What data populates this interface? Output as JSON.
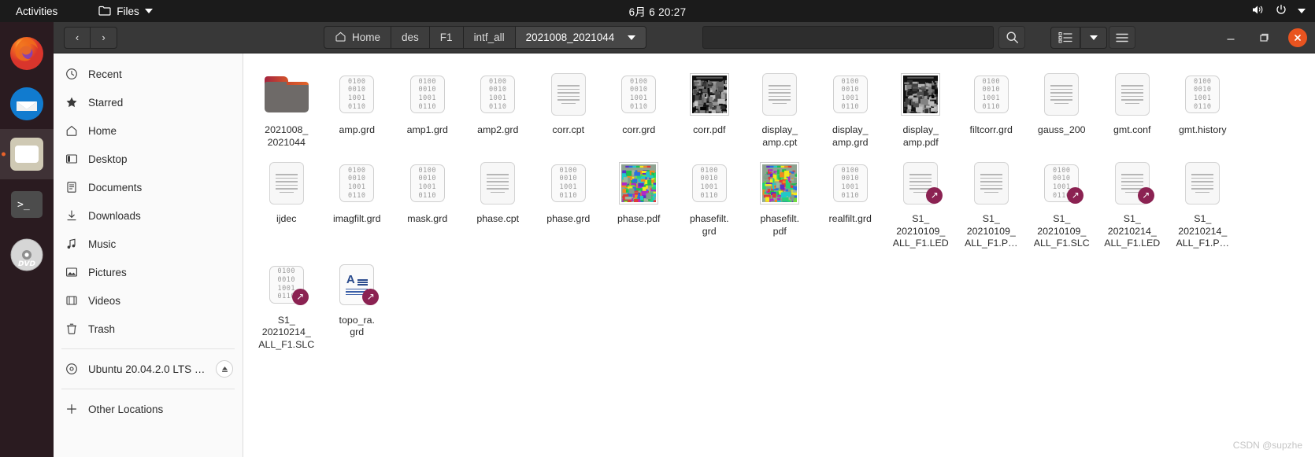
{
  "topbar": {
    "activities": "Activities",
    "app_name": "Files",
    "clock": "6月 6 20:27",
    "icons": {
      "folder": "folder-icon",
      "volume": "volume-icon",
      "power": "power-icon",
      "menu": "chevron-down-icon"
    }
  },
  "dock": {
    "items": [
      {
        "name": "firefox",
        "label": "Firefox",
        "active": false
      },
      {
        "name": "thunderbird",
        "label": "Thunderbird",
        "active": false
      },
      {
        "name": "files",
        "label": "Files",
        "active": true
      },
      {
        "name": "terminal",
        "label": "Terminal",
        "active": false
      },
      {
        "name": "dvd",
        "label": "DVD",
        "active": false
      }
    ]
  },
  "header": {
    "back": "‹",
    "forward": "›",
    "breadcrumb": [
      "Home",
      "des",
      "F1",
      "intf_all",
      "2021008_2021044"
    ],
    "path_entry_value": "",
    "search_label": "Search",
    "view_list_label": "List view",
    "view_dropdown_label": "View options",
    "menu_label": "Menu",
    "minimize": "—",
    "maximize": "❐",
    "close": "✕"
  },
  "sidebar": {
    "items": [
      {
        "label": "Recent",
        "icon": "clock-icon"
      },
      {
        "label": "Starred",
        "icon": "star-icon"
      },
      {
        "label": "Home",
        "icon": "home-icon"
      },
      {
        "label": "Desktop",
        "icon": "desktop-icon"
      },
      {
        "label": "Documents",
        "icon": "documents-icon"
      },
      {
        "label": "Downloads",
        "icon": "download-icon"
      },
      {
        "label": "Music",
        "icon": "music-icon"
      },
      {
        "label": "Pictures",
        "icon": "pictures-icon"
      },
      {
        "label": "Videos",
        "icon": "videos-icon"
      },
      {
        "label": "Trash",
        "icon": "trash-icon"
      }
    ],
    "device": {
      "label": "Ubuntu 20.04.2.0 LTS a…",
      "icon": "disc-icon",
      "eject": "⏏"
    },
    "other_locations": {
      "label": "Other Locations",
      "icon": "plus-icon"
    }
  },
  "files": [
    {
      "name": "2021008_\n2021044",
      "type": "folder",
      "symlink": false
    },
    {
      "name": "amp.grd",
      "type": "binary",
      "symlink": false
    },
    {
      "name": "amp1.grd",
      "type": "binary",
      "symlink": false
    },
    {
      "name": "amp2.grd",
      "type": "binary",
      "symlink": false
    },
    {
      "name": "corr.cpt",
      "type": "doc",
      "symlink": false
    },
    {
      "name": "corr.grd",
      "type": "binary",
      "symlink": false
    },
    {
      "name": "corr.pdf",
      "type": "image-gray",
      "symlink": false
    },
    {
      "name": "display_\namp.cpt",
      "type": "doc",
      "symlink": false
    },
    {
      "name": "display_\namp.grd",
      "type": "binary",
      "symlink": false
    },
    {
      "name": "display_\namp.pdf",
      "type": "image-gray",
      "symlink": false
    },
    {
      "name": "filtcorr.grd",
      "type": "binary",
      "symlink": false
    },
    {
      "name": "gauss_200",
      "type": "doc",
      "symlink": false
    },
    {
      "name": "gmt.conf",
      "type": "doc",
      "symlink": false
    },
    {
      "name": "gmt.history",
      "type": "binary",
      "symlink": false
    },
    {
      "name": "ijdec",
      "type": "doc",
      "symlink": false
    },
    {
      "name": "imagfilt.grd",
      "type": "binary",
      "symlink": false
    },
    {
      "name": "mask.grd",
      "type": "binary",
      "symlink": false
    },
    {
      "name": "phase.cpt",
      "type": "doc",
      "symlink": false
    },
    {
      "name": "phase.grd",
      "type": "binary",
      "symlink": false
    },
    {
      "name": "phase.pdf",
      "type": "image-color",
      "symlink": false
    },
    {
      "name": "phasefilt.\ngrd",
      "type": "binary",
      "symlink": false
    },
    {
      "name": "phasefilt.\npdf",
      "type": "image-color",
      "symlink": false
    },
    {
      "name": "realfilt.grd",
      "type": "binary",
      "symlink": false
    },
    {
      "name": "S1_\n20210109_\nALL_F1.LED",
      "type": "doc",
      "symlink": true
    },
    {
      "name": "S1_\n20210109_\nALL_F1.P…",
      "type": "doc",
      "symlink": false
    },
    {
      "name": "S1_\n20210109_\nALL_F1.SLC",
      "type": "binary",
      "symlink": true
    },
    {
      "name": "S1_\n20210214_\nALL_F1.LED",
      "type": "doc",
      "symlink": true
    },
    {
      "name": "S1_\n20210214_\nALL_F1.P…",
      "type": "doc",
      "symlink": false
    },
    {
      "name": "S1_\n20210214_\nALL_F1.SLC",
      "type": "binary",
      "symlink": true
    },
    {
      "name": "topo_ra.\ngrd",
      "type": "text",
      "symlink": true
    }
  ],
  "watermark": "CSDN @supzhe",
  "colors": {
    "accent": "#e95420",
    "symlink_badge": "#8b2252",
    "topbar_bg": "#1b1b1b",
    "headerbar_bg": "#383838",
    "sidebar_bg": "#fafafa",
    "dock_bg": "#2a1b20"
  },
  "binary_icon_text": [
    "0100",
    "0010",
    "1001",
    "0110"
  ]
}
